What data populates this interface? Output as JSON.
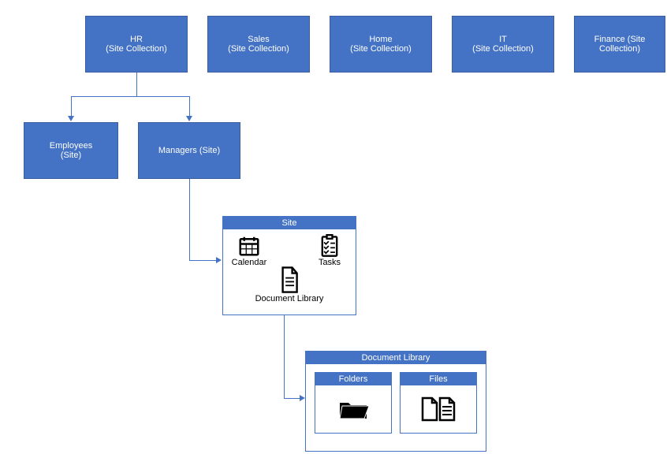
{
  "colors": {
    "primary": "#4472C4"
  },
  "top_nodes": {
    "hr": {
      "line1": "HR",
      "line2": "(Site Collection)"
    },
    "sales": {
      "line1": "Sales",
      "line2": "(Site Collection)"
    },
    "home": {
      "line1": "Home",
      "line2": "(Site Collection)"
    },
    "it": {
      "line1": "IT",
      "line2": "(Site Collection)"
    },
    "finance": {
      "line1": "Finance (Site",
      "line2": "Collection)"
    }
  },
  "second_nodes": {
    "employees": {
      "line1": "Employees",
      "line2": "(Site)"
    },
    "managers": {
      "line1": "Managers (Site)"
    }
  },
  "site_panel": {
    "title": "Site",
    "calendar": "Calendar",
    "tasks": "Tasks",
    "doclib": "Document Library"
  },
  "doclib_panel": {
    "title": "Document Library",
    "folders": "Folders",
    "files": "Files"
  }
}
